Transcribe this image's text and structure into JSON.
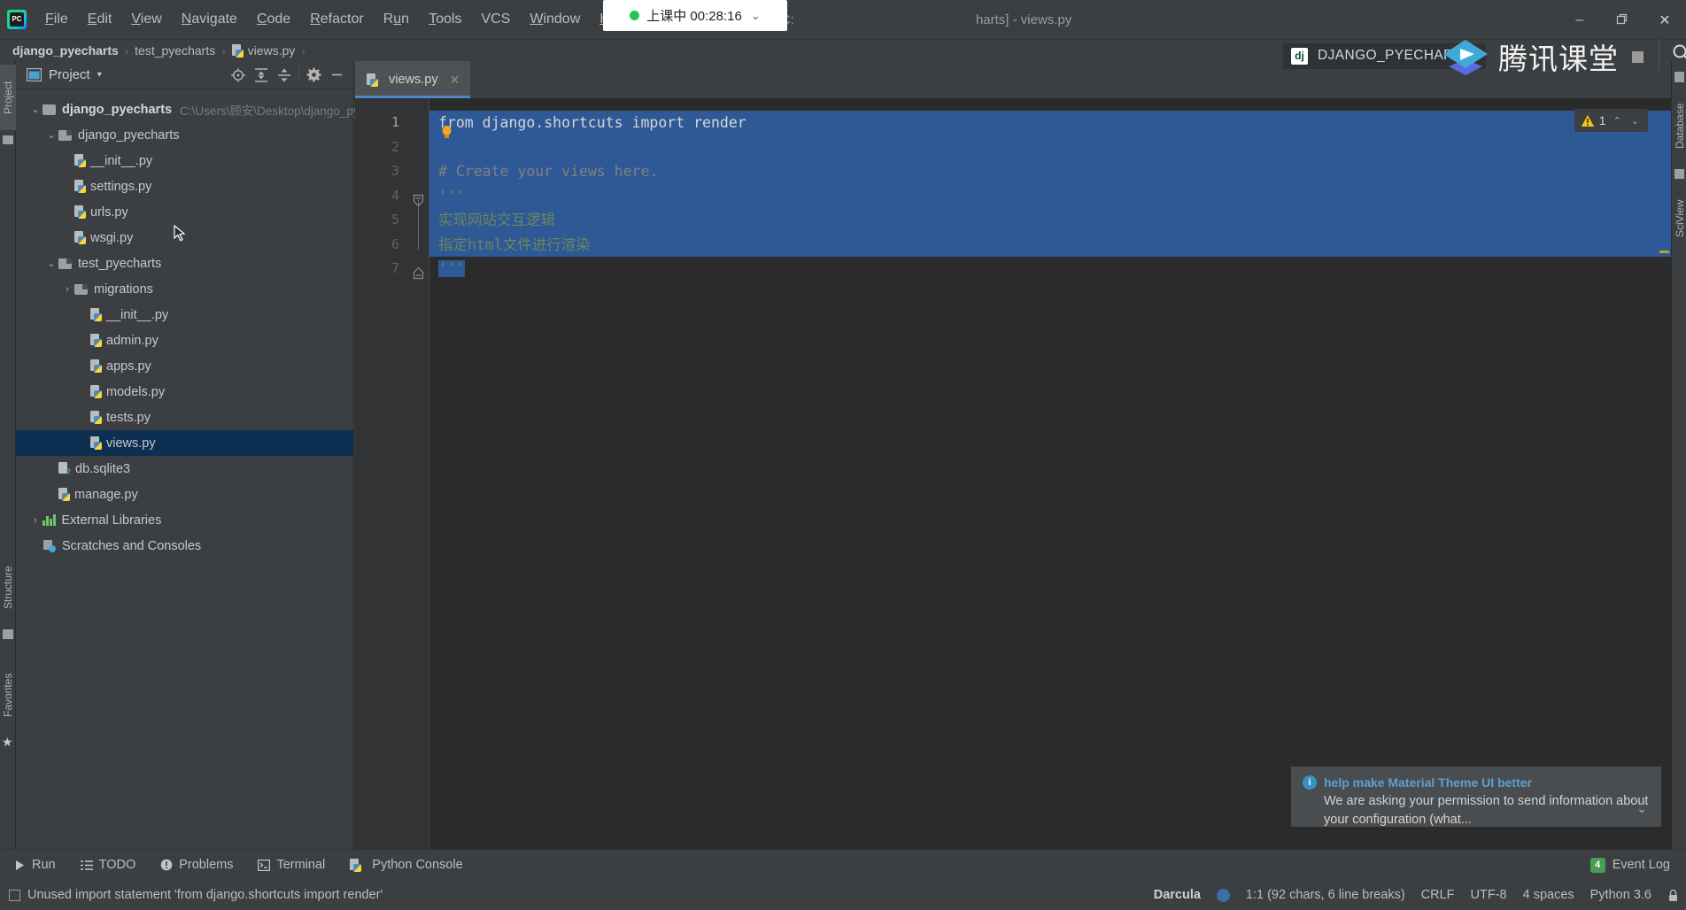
{
  "menubar": {
    "app_icon": "pycharm-logo-icon",
    "items": [
      {
        "label": "File",
        "mnemonic": "F"
      },
      {
        "label": "Edit",
        "mnemonic": "E"
      },
      {
        "label": "View",
        "mnemonic": "V"
      },
      {
        "label": "Navigate",
        "mnemonic": "N"
      },
      {
        "label": "Code",
        "mnemonic": "C"
      },
      {
        "label": "Refactor",
        "mnemonic": "R"
      },
      {
        "label": "Run",
        "mnemonic": "u"
      },
      {
        "label": "Tools",
        "mnemonic": "T"
      },
      {
        "label": "VCS",
        "mnemonic": ""
      },
      {
        "label": "Window",
        "mnemonic": "W"
      },
      {
        "label": "Help",
        "mnemonic": "H"
      }
    ],
    "window_title": "django_pyecharts [C:\\Users\\顾安\\Desktop\\django_pyecharts] - views.py",
    "window_title_left": "django_pyecharts [C:",
    "window_title_right": "harts] - views.py",
    "controls": {
      "minimize": "–",
      "maximize": "❐",
      "close": "✕"
    }
  },
  "class_pill": {
    "status_text": "上课中 00:28:16",
    "dot_color": "#24c659",
    "chevron": "⌄"
  },
  "breadcrumb": {
    "items": [
      "django_pyecharts",
      "test_pyecharts",
      "views.py"
    ],
    "separator": "›"
  },
  "left_stripe": {
    "items": [
      {
        "label": "Project",
        "active": true
      },
      {
        "label": "Structure",
        "active": false
      },
      {
        "label": "Favorites",
        "active": false
      }
    ]
  },
  "right_stripe": {
    "items": [
      {
        "label": "Database"
      },
      {
        "label": "SciView"
      }
    ]
  },
  "project_panel": {
    "title": "Project",
    "dropdown_chevron": "▾",
    "toolbar_icons": [
      "locate-target-icon",
      "expand-all-icon",
      "collapse-all-icon",
      "gear-icon",
      "hide-panel-icon"
    ],
    "tree": [
      {
        "label": "django_pyecharts",
        "path": "C:\\Users\\顾安\\Desktop\\django_pyech",
        "depth": 0,
        "type": "folder-root",
        "arrow": "⌄",
        "bold": true,
        "selected": false
      },
      {
        "label": "django_pyecharts",
        "path": "",
        "depth": 1,
        "type": "folder-module",
        "arrow": "⌄",
        "bold": false,
        "selected": false
      },
      {
        "label": "__init__.py",
        "path": "",
        "depth": 2,
        "type": "python-file",
        "arrow": "",
        "bold": false,
        "selected": false
      },
      {
        "label": "settings.py",
        "path": "",
        "depth": 2,
        "type": "python-file",
        "arrow": "",
        "bold": false,
        "selected": false
      },
      {
        "label": "urls.py",
        "path": "",
        "depth": 2,
        "type": "python-file",
        "arrow": "",
        "bold": false,
        "selected": false
      },
      {
        "label": "wsgi.py",
        "path": "",
        "depth": 2,
        "type": "python-file",
        "arrow": "",
        "bold": false,
        "selected": false
      },
      {
        "label": "test_pyecharts",
        "path": "",
        "depth": 1,
        "type": "folder-module",
        "arrow": "⌄",
        "bold": false,
        "selected": false
      },
      {
        "label": "migrations",
        "path": "",
        "depth": 2,
        "type": "folder-module",
        "arrow": "›",
        "bold": false,
        "selected": false
      },
      {
        "label": "__init__.py",
        "path": "",
        "depth": 3,
        "type": "python-file",
        "arrow": "",
        "bold": false,
        "selected": false
      },
      {
        "label": "admin.py",
        "path": "",
        "depth": 3,
        "type": "python-file",
        "arrow": "",
        "bold": false,
        "selected": false
      },
      {
        "label": "apps.py",
        "path": "",
        "depth": 3,
        "type": "python-file",
        "arrow": "",
        "bold": false,
        "selected": false
      },
      {
        "label": "models.py",
        "path": "",
        "depth": 3,
        "type": "python-file",
        "arrow": "",
        "bold": false,
        "selected": false
      },
      {
        "label": "tests.py",
        "path": "",
        "depth": 3,
        "type": "python-file",
        "arrow": "",
        "bold": false,
        "selected": false
      },
      {
        "label": "views.py",
        "path": "",
        "depth": 3,
        "type": "python-file",
        "arrow": "",
        "bold": false,
        "selected": true
      },
      {
        "label": "db.sqlite3",
        "path": "",
        "depth": 1,
        "type": "db-file",
        "arrow": "",
        "bold": false,
        "selected": false
      },
      {
        "label": "manage.py",
        "path": "",
        "depth": 1,
        "type": "python-file",
        "arrow": "",
        "bold": false,
        "selected": false
      },
      {
        "label": "External Libraries",
        "path": "",
        "depth": 0,
        "type": "libraries",
        "arrow": "›",
        "bold": false,
        "selected": false
      },
      {
        "label": "Scratches and Consoles",
        "path": "",
        "depth": 0,
        "type": "scratches",
        "arrow": "",
        "bold": false,
        "selected": false
      }
    ]
  },
  "editor": {
    "tab": {
      "label": "views.py",
      "close": "✕"
    },
    "line_numbers": [
      "1",
      "2",
      "3",
      "4",
      "5",
      "6",
      "7"
    ],
    "current_line": "1",
    "lines": [
      {
        "num": "1",
        "text": "from django.shortcuts import render",
        "kind": "code",
        "selected": true
      },
      {
        "num": "2",
        "text": "",
        "kind": "blank",
        "selected": true
      },
      {
        "num": "3",
        "text": "# Create your views here.",
        "kind": "comment",
        "selected": true
      },
      {
        "num": "4",
        "text": "'''",
        "kind": "string",
        "selected": true
      },
      {
        "num": "5",
        "text": "实现网站交互逻辑",
        "kind": "string",
        "selected": true
      },
      {
        "num": "6",
        "text": "指定html文件进行渲染",
        "kind": "string",
        "selected": true
      },
      {
        "num": "7",
        "text": "'''",
        "kind": "string",
        "selected": true
      }
    ],
    "inspection": {
      "warning_count": "1",
      "up": "⌃",
      "down": "⌄",
      "icon": "warning-triangle-icon"
    }
  },
  "tencent_overlay": {
    "project_chip": {
      "icon_text": "dj",
      "name": "DJANGO_PYECHARTS"
    },
    "brand_text": "腾讯课堂",
    "logo": "tencent-classroom-logo-icon"
  },
  "notification": {
    "title": "help make Material Theme UI better",
    "body": "We are asking your permission to send information about your configuration (what...",
    "icon": "info-icon",
    "chevron": "⌄"
  },
  "bottom_bar": {
    "items": [
      {
        "label": "Run",
        "icon": "play-icon"
      },
      {
        "label": "TODO",
        "icon": "list-icon"
      },
      {
        "label": "Problems",
        "icon": "exclamation-circle-icon"
      },
      {
        "label": "Terminal",
        "icon": "terminal-icon"
      },
      {
        "label": "Python Console",
        "icon": "python-icon"
      }
    ],
    "event_log": {
      "label": "Event Log",
      "count": "4"
    }
  },
  "status_bar": {
    "message": "Unused import statement 'from django.shortcuts import render'",
    "theme": "Darcula",
    "caret": "1:1 (92 chars, 6 line breaks)",
    "line_separator": "CRLF",
    "encoding": "UTF-8",
    "indent": "4 spaces",
    "interpreter": "Python 3.6",
    "lock_icon": "lock-icon"
  },
  "colors": {
    "accent": "#4a88c7",
    "selection": "#2f5896",
    "tree_selection": "#0d2f52",
    "background": "#3c3f41",
    "editor_bg": "#2b2b2b",
    "string": "#6a8759",
    "keyword": "#cc7832",
    "comment": "#808080",
    "green_status": "#24c659"
  }
}
